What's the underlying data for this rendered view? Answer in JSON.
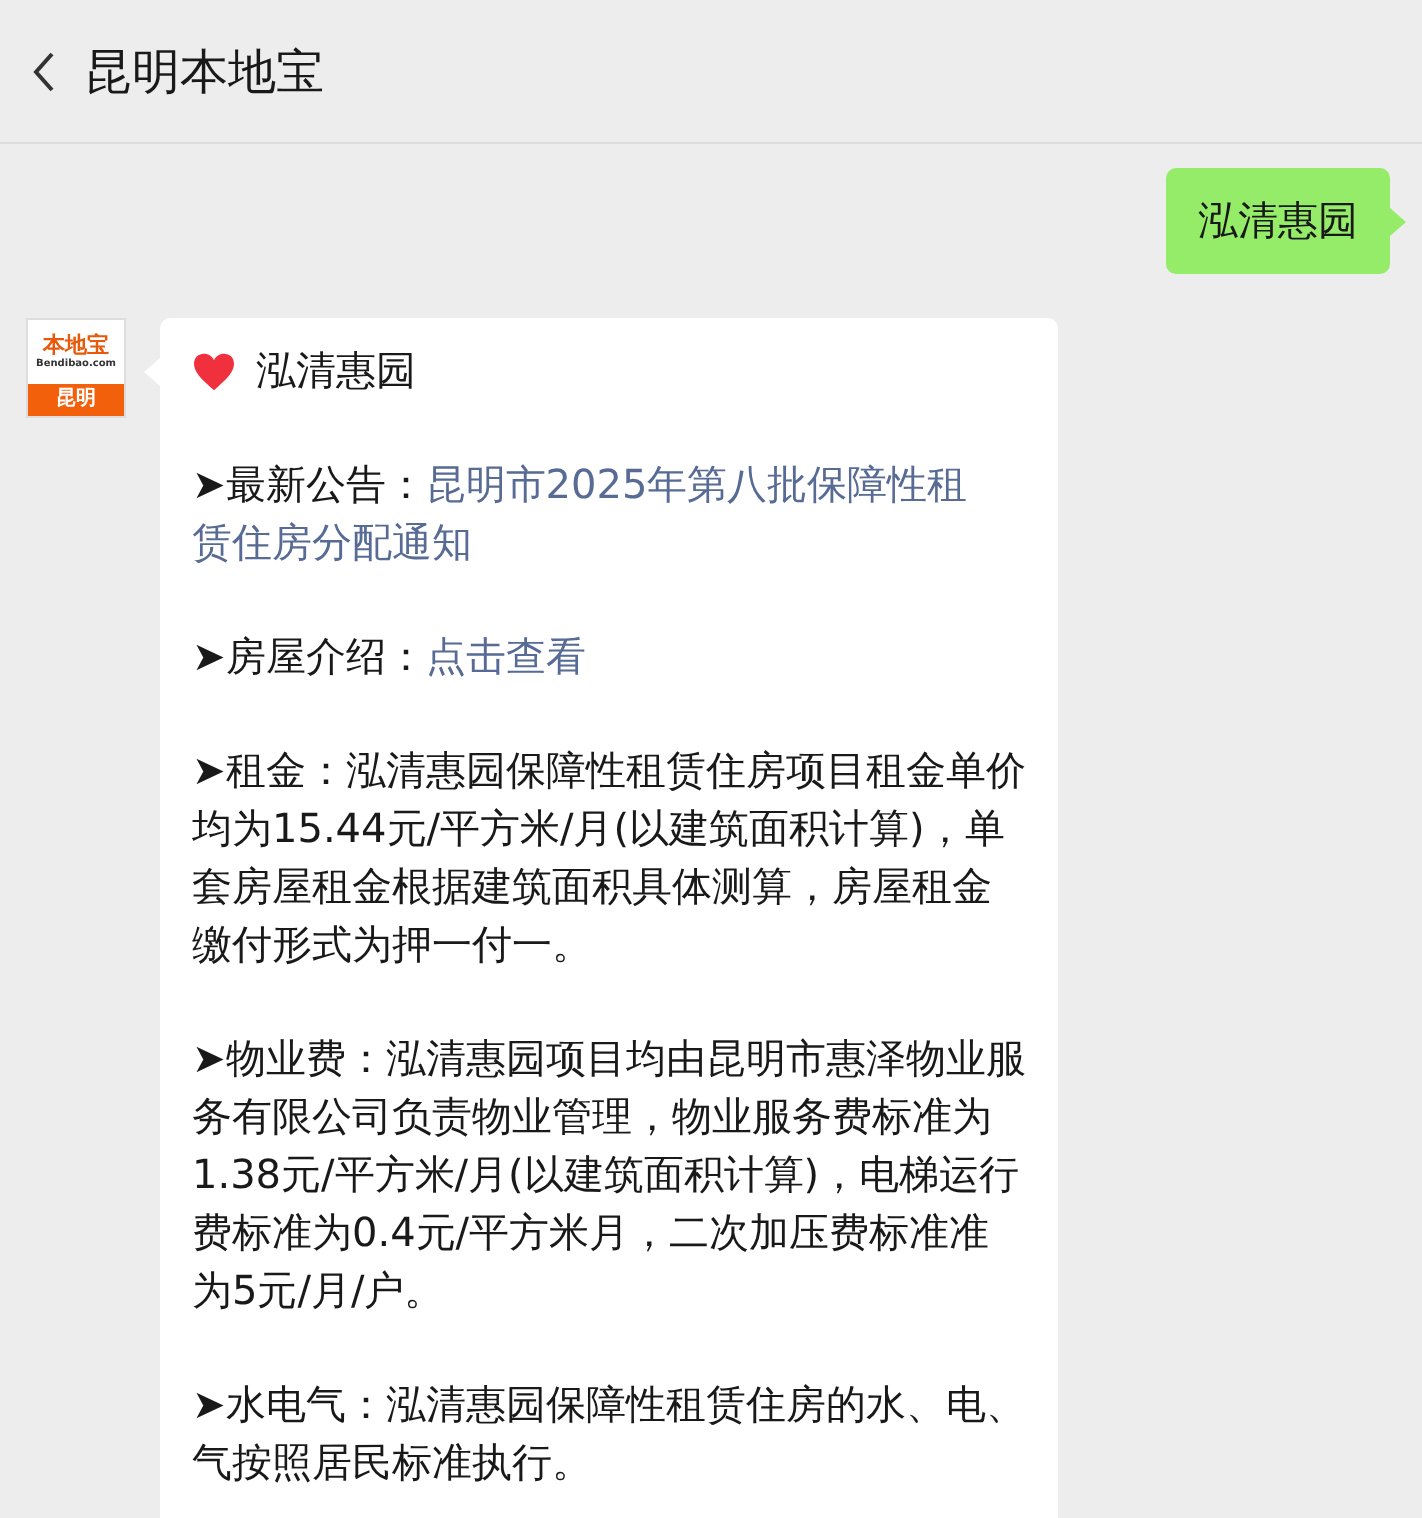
{
  "header": {
    "title": "昆明本地宝"
  },
  "sent_message": {
    "text": "泓清惠园"
  },
  "received_message": {
    "avatar": {
      "logo_text": "本地宝",
      "domain": "Bendibao.com",
      "city": "昆明"
    },
    "title": "泓清惠园",
    "paragraphs": [
      {
        "bullet": "➤",
        "label": "最新公告：",
        "link_lines": [
          "昆明市2025年第八批保障性租",
          "赁住房分配通知"
        ]
      },
      {
        "bullet": "➤",
        "label": "房屋介绍：",
        "link": "点击查看"
      },
      {
        "bullet": "➤",
        "label": "租金：",
        "text": "泓清惠园保障性租赁住房项目租金单价均为15.44元/平方米/月(以建筑面积计算)，单套房屋租金根据建筑面积具体测算，房屋租金缴付形式为押一付一。"
      },
      {
        "bullet": "➤",
        "label": "物业费：",
        "text": "泓清惠园项目均由昆明市惠泽物业服务有限公司负责物业管理，物业服务费标准为1.38元/平方米/月(以建筑面积计算)，电梯运行费标准为0.4元/平方米月，二次加压费标准准为5元/月/户。"
      },
      {
        "bullet": "➤",
        "label": "水电气：",
        "text": "泓清惠园保障性租赁住房的水、电、气按照居民标准执行。"
      }
    ]
  }
}
